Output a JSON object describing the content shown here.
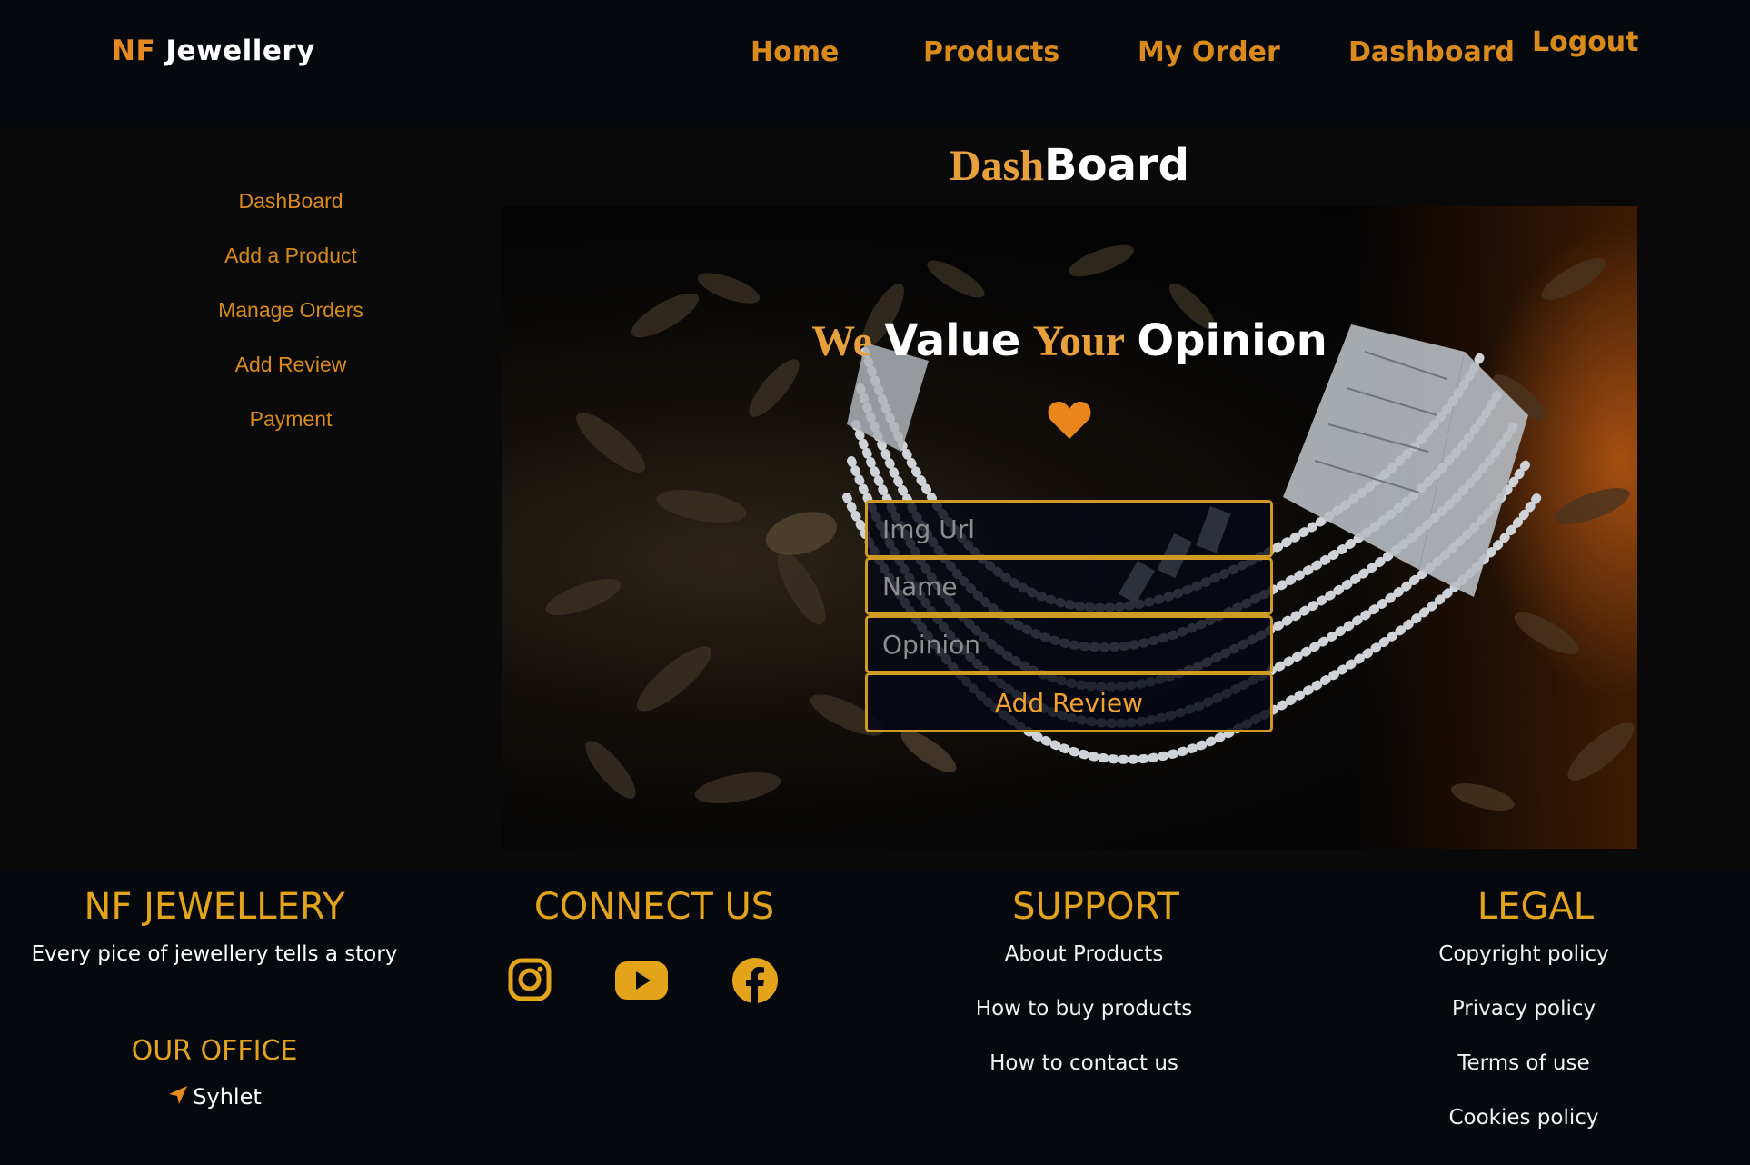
{
  "navbar": {
    "brand_accent": "NF",
    "brand_rest": "Jewellery",
    "links": [
      "Home",
      "Products",
      "My Order",
      "Dashboard",
      "Logout"
    ]
  },
  "sidebar": {
    "items": [
      "DashBoard",
      "Add a Product",
      "Manage Orders",
      "Add Review",
      "Payment"
    ]
  },
  "page_title": {
    "part1": "Dash",
    "part2": "Board"
  },
  "review_form": {
    "heading": [
      "We",
      "Value",
      "Your",
      "Opinion"
    ],
    "heart_icon": "heart-icon",
    "fields": {
      "img_url_placeholder": "Img Url",
      "name_placeholder": "Name",
      "opinion_placeholder": "Opinion"
    },
    "submit_label": "Add Review"
  },
  "footer": {
    "brand": {
      "heading": "NF JEWELLERY",
      "tagline": "Every pice of jewellery tells a story",
      "office_heading": "OUR OFFICE",
      "office_location": "Syhlet",
      "location_icon": "location-arrow-icon"
    },
    "connect": {
      "heading": "CONNECT US",
      "icons": [
        "instagram-icon",
        "youtube-icon",
        "facebook-icon"
      ]
    },
    "support": {
      "heading": "SUPPORT",
      "links": [
        "About Products",
        "How to buy products",
        "How to contact us"
      ]
    },
    "legal": {
      "heading": "LEGAL",
      "links": [
        "Copyright policy",
        "Privacy policy",
        "Terms of use",
        "Cookies policy"
      ]
    }
  },
  "colors": {
    "accent": "#d98a1a",
    "gold": "#e3a41c",
    "background": "#05080d",
    "panel": "#090909"
  }
}
